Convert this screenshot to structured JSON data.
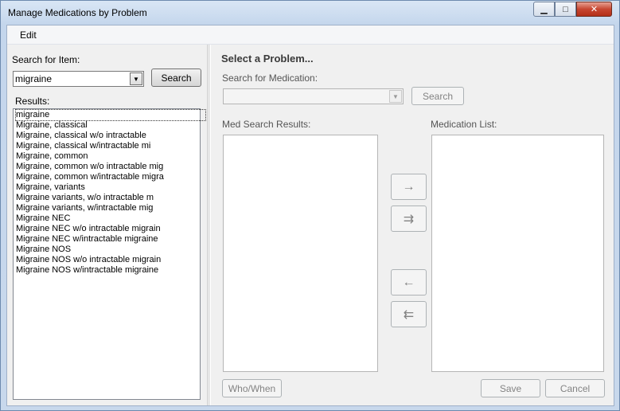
{
  "window": {
    "title": "Manage Medications by Problem",
    "minimize_glyph": "▁",
    "maximize_glyph": "□",
    "close_glyph": "✕"
  },
  "menu": {
    "items": [
      "Edit"
    ]
  },
  "left": {
    "search_label": "Search for Item:",
    "search_value": "migraine",
    "search_button": "Search",
    "results_label": "Results:",
    "results": [
      "migraine",
      "Migraine, classical",
      "Migraine, classical w/o intractable",
      "Migraine, classical w/intractable mi",
      "Migraine, common",
      "Migraine, common w/o intractable mig",
      "Migraine, common w/intractable migra",
      "Migraine, variants",
      "Migraine variants, w/o intractable m",
      "Migraine variants, w/intractable mig",
      "Migraine NEC",
      "Migraine NEC w/o intractable migrain",
      "Migraine NEC w/intractable migraine",
      "Migraine NOS",
      "Migraine NOS w/o intractable migrain",
      "Migraine NOS w/intractable migraine"
    ]
  },
  "right": {
    "heading": "Select a Problem...",
    "med_search_label": "Search for Medication:",
    "med_search_value": "",
    "med_search_button": "Search",
    "med_results_label": "Med Search Results:",
    "med_list_label": "Medication List:",
    "move_right": "→",
    "move_all_right": "⇉",
    "move_left": "←",
    "move_all_left": "⇇",
    "who_when_button": "Who/When",
    "save_button": "Save",
    "cancel_button": "Cancel"
  }
}
